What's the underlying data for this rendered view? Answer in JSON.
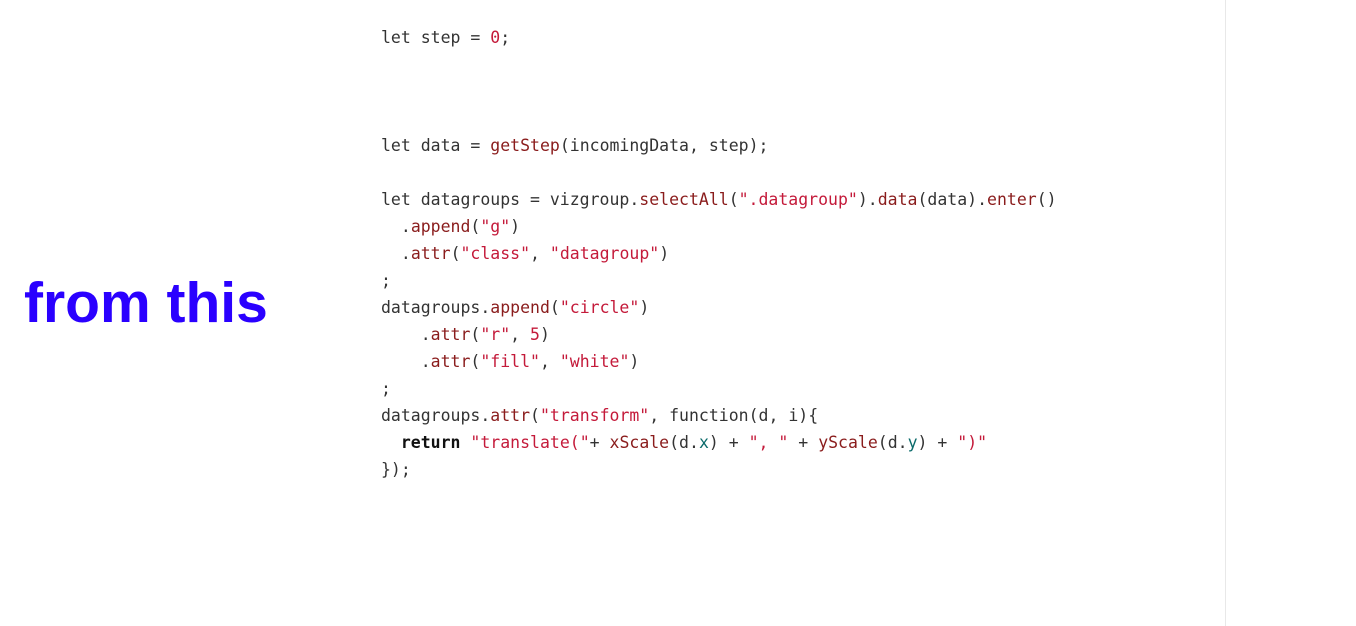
{
  "caption": {
    "text": "from this",
    "color": "#2a00ff"
  },
  "code": {
    "colors": {
      "plain": "#333333",
      "function": "#8a1c1c",
      "string": "#c41a3a",
      "number": "#c41a3a",
      "property": "#0b6b6b",
      "keyword": "#111111"
    },
    "lines": [
      [
        [
          "p",
          "let step = "
        ],
        [
          "n",
          "0"
        ],
        [
          "p",
          ";"
        ]
      ],
      [
        [
          "p",
          "let data = "
        ],
        [
          "f",
          "getStep"
        ],
        [
          "p",
          "(incomingData, step);"
        ]
      ],
      [
        [
          "p",
          "let datagroups = vizgroup."
        ],
        [
          "f",
          "selectAll"
        ],
        [
          "p",
          "("
        ],
        [
          "s",
          "\".datagroup\""
        ],
        [
          "p",
          ")."
        ],
        [
          "f",
          "data"
        ],
        [
          "p",
          "(data)."
        ],
        [
          "f",
          "enter"
        ],
        [
          "p",
          "()"
        ]
      ],
      [
        [
          "p",
          "  ."
        ],
        [
          "f",
          "append"
        ],
        [
          "p",
          "("
        ],
        [
          "s",
          "\"g\""
        ],
        [
          "p",
          ")"
        ]
      ],
      [
        [
          "p",
          "  ."
        ],
        [
          "f",
          "attr"
        ],
        [
          "p",
          "("
        ],
        [
          "s",
          "\"class\""
        ],
        [
          "p",
          ", "
        ],
        [
          "s",
          "\"datagroup\""
        ],
        [
          "p",
          ")"
        ]
      ],
      [
        [
          "p",
          ";"
        ]
      ],
      [
        [
          "p",
          "datagroups."
        ],
        [
          "f",
          "append"
        ],
        [
          "p",
          "("
        ],
        [
          "s",
          "\"circle\""
        ],
        [
          "p",
          ")"
        ]
      ],
      [
        [
          "p",
          "    ."
        ],
        [
          "f",
          "attr"
        ],
        [
          "p",
          "("
        ],
        [
          "s",
          "\"r\""
        ],
        [
          "p",
          ", "
        ],
        [
          "n",
          "5"
        ],
        [
          "p",
          ")"
        ]
      ],
      [
        [
          "p",
          "    ."
        ],
        [
          "f",
          "attr"
        ],
        [
          "p",
          "("
        ],
        [
          "s",
          "\"fill\""
        ],
        [
          "p",
          ", "
        ],
        [
          "s",
          "\"white\""
        ],
        [
          "p",
          ")"
        ]
      ],
      [
        [
          "p",
          ";"
        ]
      ],
      [
        [
          "p",
          "datagroups."
        ],
        [
          "f",
          "attr"
        ],
        [
          "p",
          "("
        ],
        [
          "s",
          "\"transform\""
        ],
        [
          "p",
          ", function(d, i){"
        ]
      ],
      [
        [
          "p",
          "  "
        ],
        [
          "k",
          "return"
        ],
        [
          "p",
          " "
        ],
        [
          "s",
          "\"translate(\""
        ],
        [
          "p",
          "+ "
        ],
        [
          "f",
          "xScale"
        ],
        [
          "p",
          "(d."
        ],
        [
          "x",
          "x"
        ],
        [
          "p",
          ") + "
        ],
        [
          "s",
          "\", \""
        ],
        [
          "p",
          " + "
        ],
        [
          "f",
          "yScale"
        ],
        [
          "p",
          "(d."
        ],
        [
          "x",
          "y"
        ],
        [
          "p",
          ") + "
        ],
        [
          "s",
          "\")\""
        ]
      ],
      [
        [
          "p",
          "});"
        ]
      ]
    ]
  }
}
